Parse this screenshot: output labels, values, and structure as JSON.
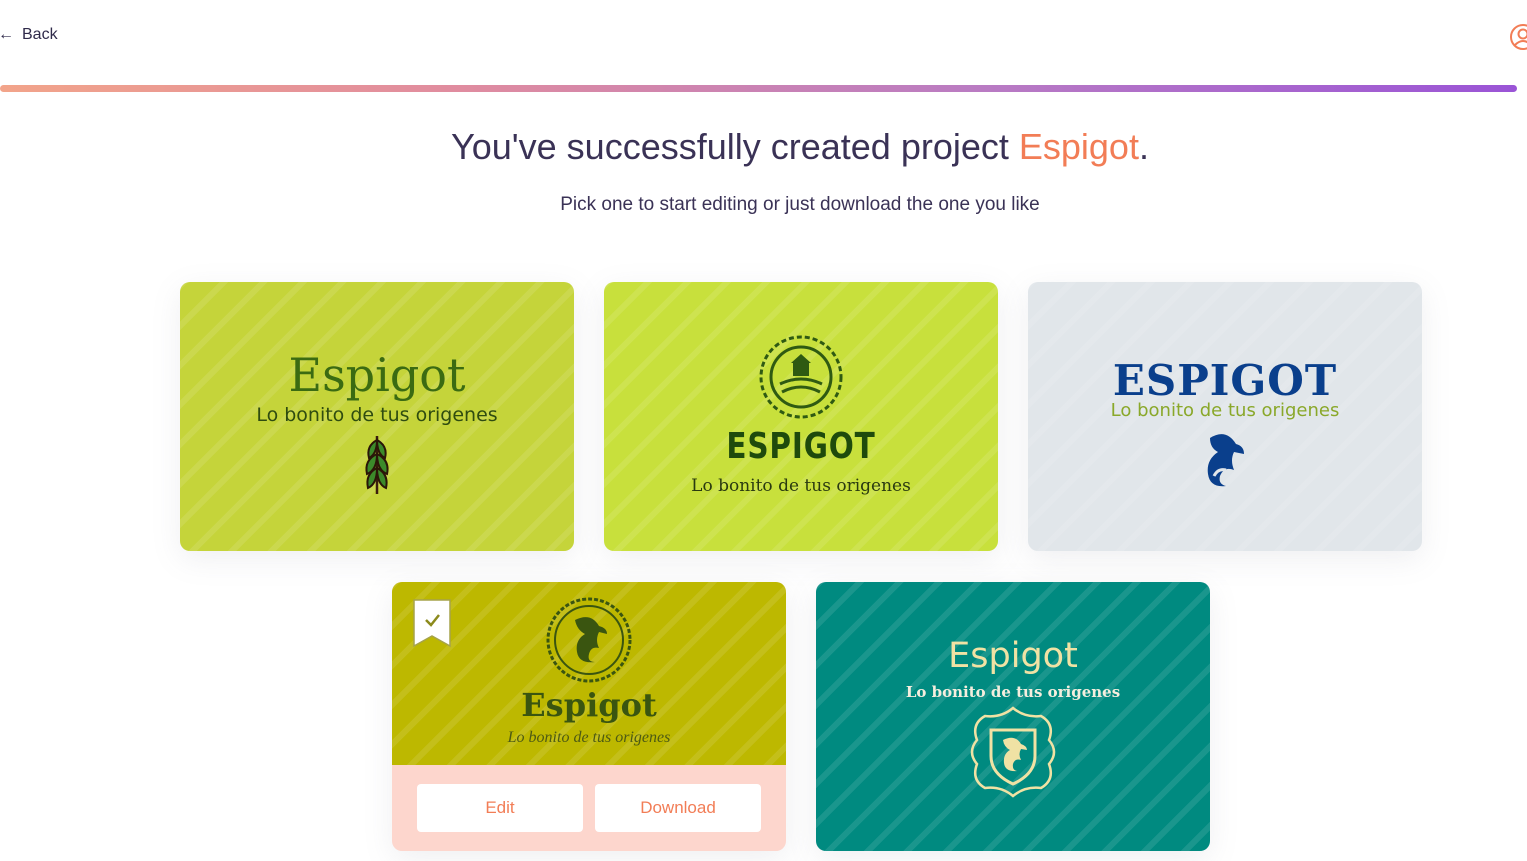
{
  "header": {
    "back_label": "Back",
    "back_arrow": "←",
    "user_icon": "user-circle-icon"
  },
  "progress": {
    "value": 1.0
  },
  "main": {
    "headline_prefix": "You've successfully created project ",
    "project_name": "Espigot",
    "headline_suffix": ".",
    "subtitle": "Pick one to start editing or just download the one you like"
  },
  "colors": {
    "accent": "#f27d56",
    "text": "#3a3256",
    "card1_bg": "#c5d43a",
    "card2_bg": "#c8e03c",
    "card3_bg": "#e1e6ea",
    "card4_bg": "#bdb800",
    "card4_actions_bg": "#fdd6cd",
    "card5_bg": "#008a80"
  },
  "logos": [
    {
      "name": "Espigot",
      "tagline": "Lo bonito de tus origenes",
      "icon": "wheat-icon"
    },
    {
      "name": "ESPIGOT",
      "tagline": "Lo bonito de tus origenes",
      "icon": "farm-emblem-icon"
    },
    {
      "name": "ESPIGOT",
      "tagline": "Lo bonito de tus origenes",
      "icon": "goat-icon"
    },
    {
      "name": "Espigot",
      "tagline": "Lo bonito de tus origenes",
      "icon": "goat-emblem-icon",
      "selected": true
    },
    {
      "name": "Espigot",
      "tagline": "Lo bonito de tus origenes",
      "icon": "goat-shield-icon"
    }
  ],
  "actions": {
    "edit_label": "Edit",
    "download_label": "Download"
  }
}
